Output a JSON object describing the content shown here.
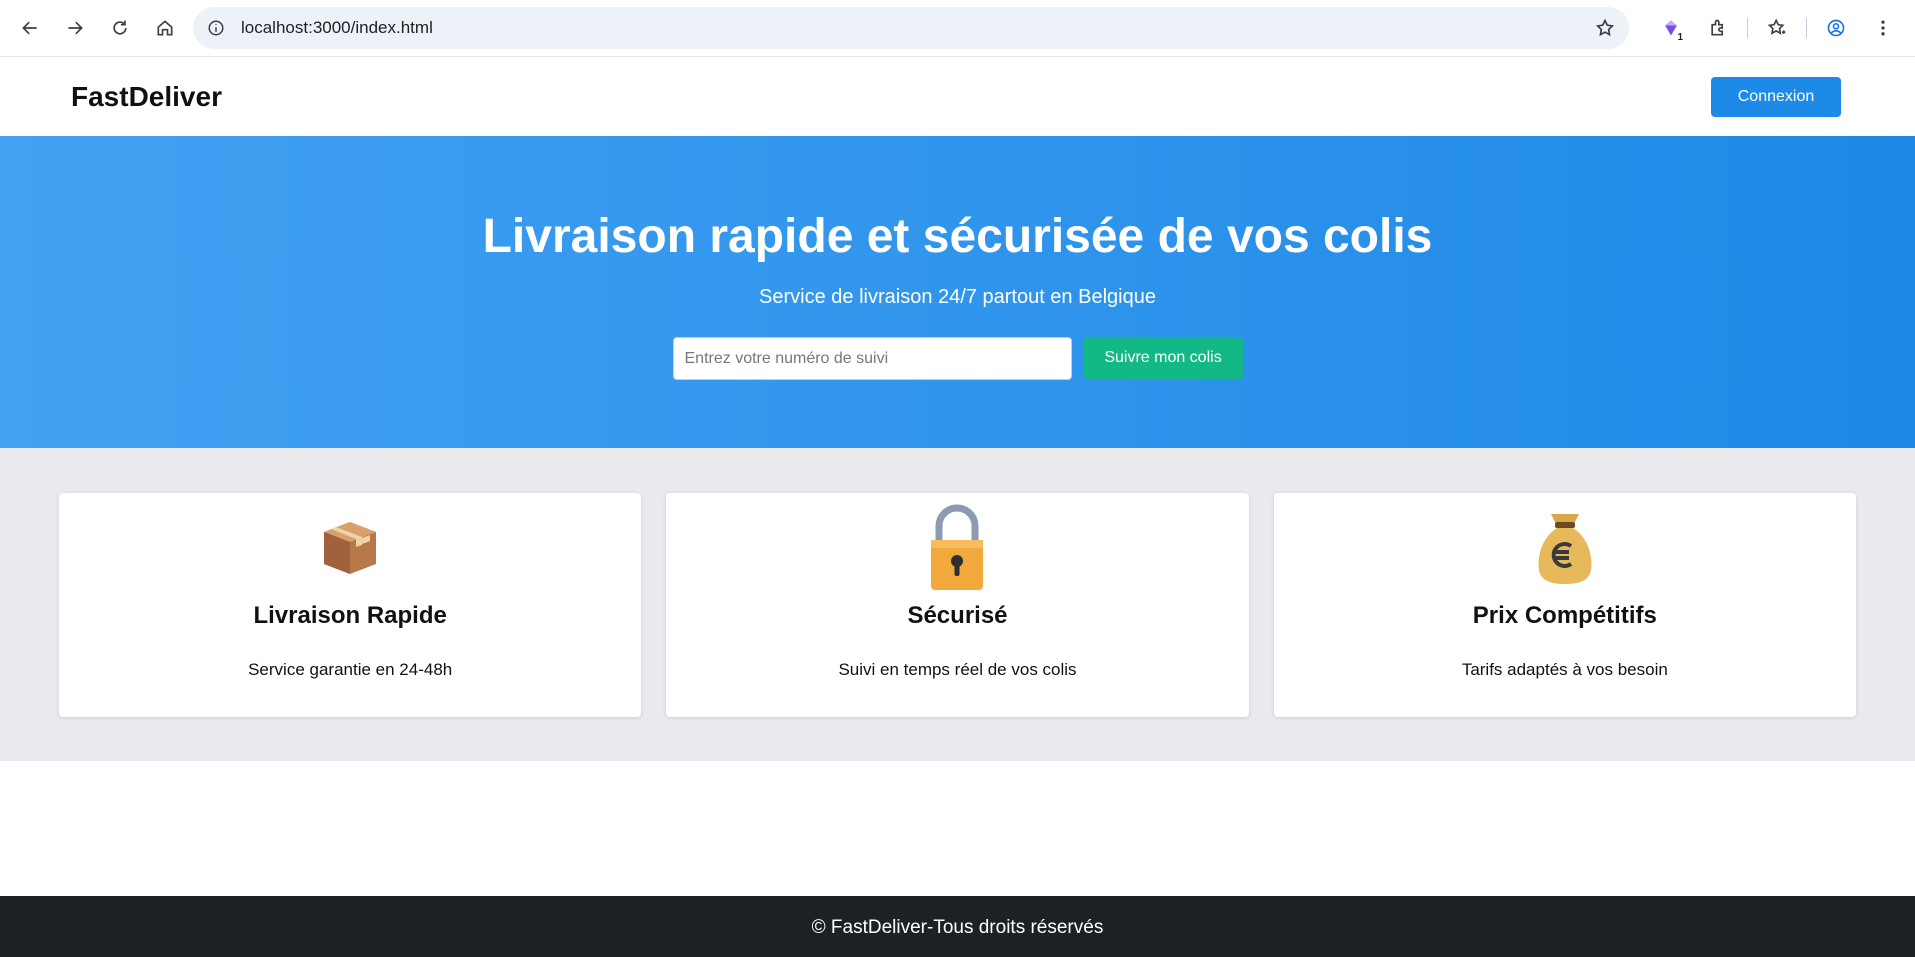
{
  "browser": {
    "url": "localhost:3000/index.html",
    "extension_badge": "1"
  },
  "header": {
    "logo": "FastDeliver",
    "login_label": "Connexion"
  },
  "hero": {
    "title": "Livraison rapide et sécurisée de vos colis",
    "subtitle": "Service de livraison 24/7 partout en Belgique",
    "search_placeholder": "Entrez votre numéro de suivi",
    "search_value": "",
    "track_button": "Suivre mon colis"
  },
  "features": [
    {
      "icon": "package-icon",
      "title": "Livraison Rapide",
      "text": "Service garantie en 24-48h"
    },
    {
      "icon": "lock-icon",
      "title": "Sécurisé",
      "text": "Suivi en temps réel de vos colis"
    },
    {
      "icon": "money-bag-icon",
      "title": "Prix Compétitifs",
      "text": "Tarifs adaptés à vos besoin"
    }
  ],
  "footer": {
    "text": "© FastDeliver-Tous droits réservés"
  },
  "colors": {
    "hero_start": "#42a1f2",
    "hero_end": "#1e89e6",
    "primary_button": "#1c8ae6",
    "track_button": "#12b886",
    "features_bg": "#e9eaee",
    "footer_bg": "#1e2124"
  }
}
